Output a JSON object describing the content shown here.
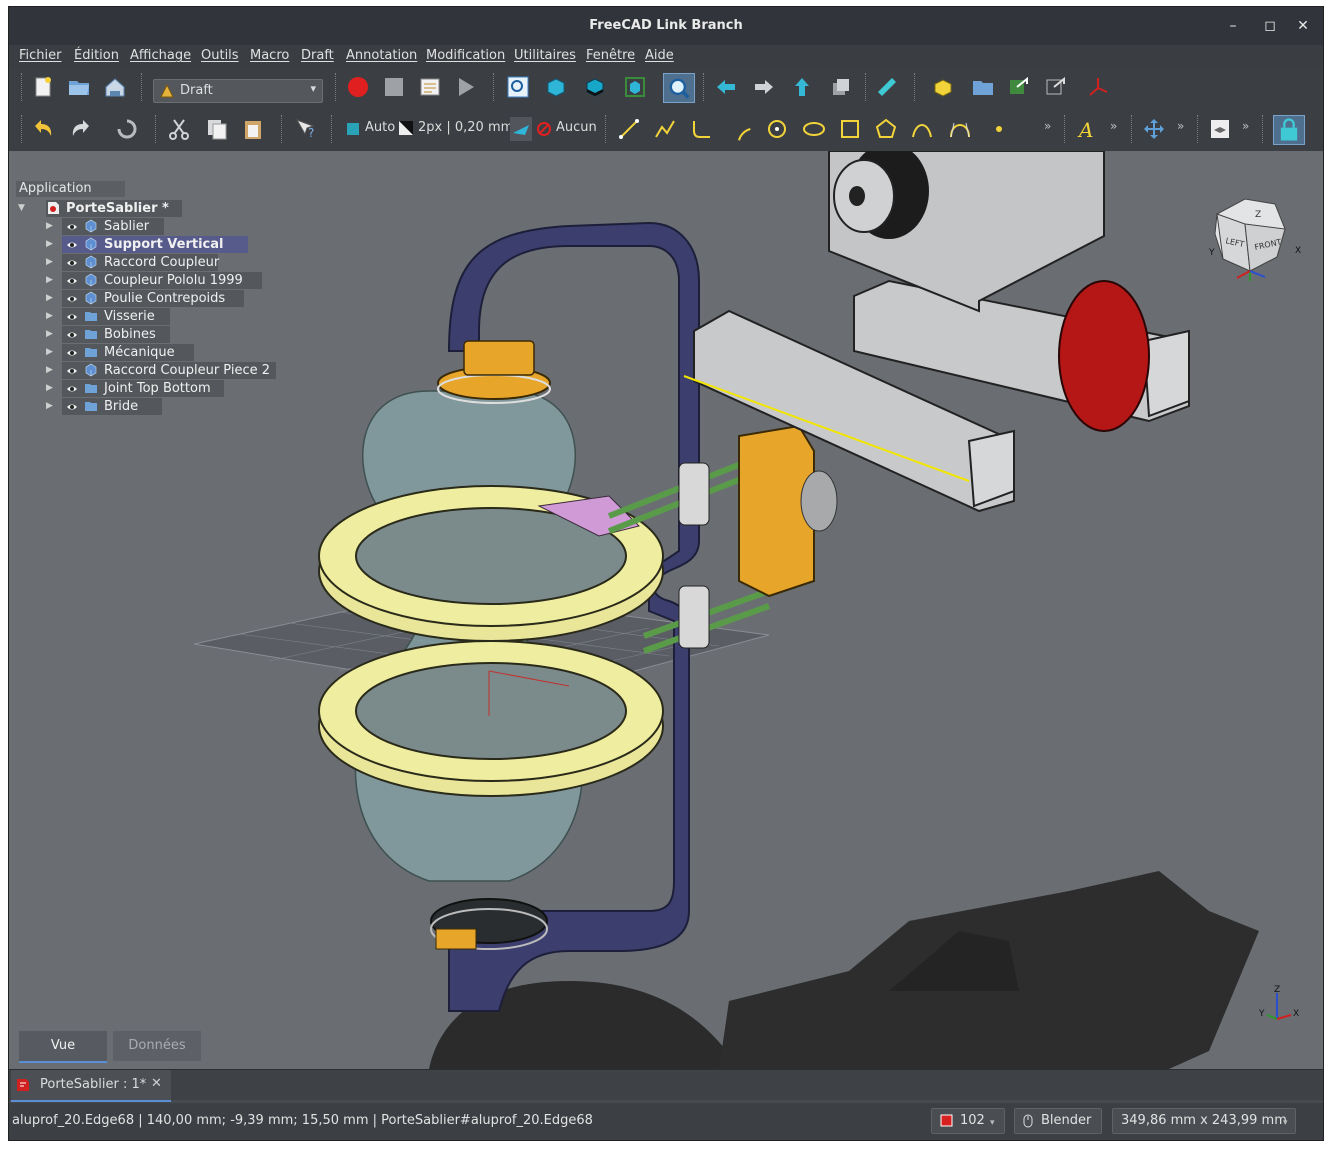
{
  "window": {
    "title": "FreeCAD Link Branch",
    "minimize": "–",
    "maximize": "◻",
    "close": "✕"
  },
  "menubar": [
    "Fichier",
    "Édition",
    "Affichage",
    "Outils",
    "Macro",
    "Draft",
    "Annotation",
    "Modification",
    "Utilitaires",
    "Fenêtre",
    "Aide"
  ],
  "toolbar": {
    "workbench_selector": "Draft",
    "construction_mode": "Auto",
    "line_style": "2px | 0,20 mm",
    "snap_setting": "Aucun",
    "overflow_label": "»"
  },
  "tree": {
    "header": "Application",
    "document": "PorteSablier *",
    "items": [
      {
        "label": "Sablier",
        "icon": "part-icon",
        "selected": false
      },
      {
        "label": "Support Vertical",
        "icon": "part-icon",
        "selected": true
      },
      {
        "label": "Raccord Coupleur",
        "icon": "part-icon",
        "selected": false
      },
      {
        "label": "Coupleur Pololu 1999",
        "icon": "part-icon",
        "selected": false
      },
      {
        "label": "Poulie Contrepoids",
        "icon": "part-icon",
        "selected": false
      },
      {
        "label": "Visserie",
        "icon": "folder-icon",
        "selected": false
      },
      {
        "label": "Bobines",
        "icon": "folder-icon",
        "selected": false
      },
      {
        "label": "Mécanique",
        "icon": "folder-icon",
        "selected": false
      },
      {
        "label": "Raccord Coupleur Piece 2",
        "icon": "part-icon",
        "selected": false
      },
      {
        "label": "Joint Top Bottom",
        "icon": "folder-icon",
        "selected": false
      },
      {
        "label": "Bride",
        "icon": "folder-icon",
        "selected": false
      }
    ]
  },
  "navcube": {
    "top": "Z",
    "left": "LEFT",
    "front": "FRONT",
    "axis_x": "X",
    "axis_y": "Y"
  },
  "axis_indicator": {
    "x": "X",
    "y": "Y",
    "z": "Z"
  },
  "panel_tabs": [
    {
      "label": "Vue",
      "active": true
    },
    {
      "label": "Données",
      "active": false
    }
  ],
  "document_tab": {
    "label": "PorteSablier : 1*",
    "close": "✕"
  },
  "statusbar": {
    "message": "aluprof_20.Edge68 | 140,00 mm; -9,39 mm; 15,50 mm | PorteSablier#aluprof_20.Edge68",
    "cache_count": "102",
    "navigation_style": "Blender",
    "dimensions": "349,86 mm x 243,99 mm"
  },
  "colors": {
    "accent": "#5a8fd6",
    "selection": "#575b8c",
    "viewport": "#6a6e73"
  }
}
